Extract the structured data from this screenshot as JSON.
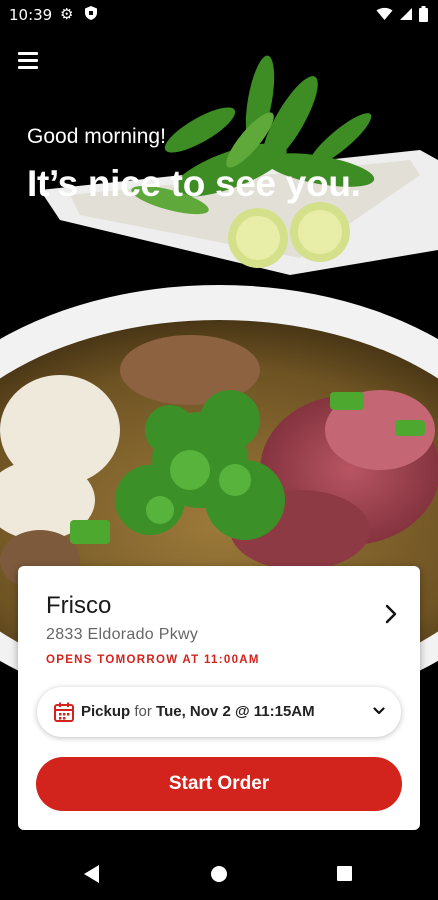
{
  "status_bar": {
    "time": "10:39"
  },
  "header": {
    "greeting": "Good morning!",
    "headline": "It’s nice to see you."
  },
  "location": {
    "name": "Frisco",
    "address": "2833 Eldorado Pkwy",
    "hours_status": "OPENS TOMORROW AT 11:00AM"
  },
  "pickup": {
    "mode": "Pickup",
    "connector": "for",
    "datetime": "Tue, Nov 2 @ 11:15AM"
  },
  "actions": {
    "start_order": "Start Order"
  },
  "colors": {
    "accent": "#d3231d",
    "background": "#000000",
    "card": "#ffffff"
  },
  "icons": [
    "menu-icon",
    "gear-icon",
    "shield-icon",
    "wifi-icon",
    "signal-icon",
    "battery-icon",
    "chevron-right-icon",
    "calendar-icon",
    "chevron-down-icon",
    "nav-back-icon",
    "nav-home-icon",
    "nav-recent-icon"
  ]
}
